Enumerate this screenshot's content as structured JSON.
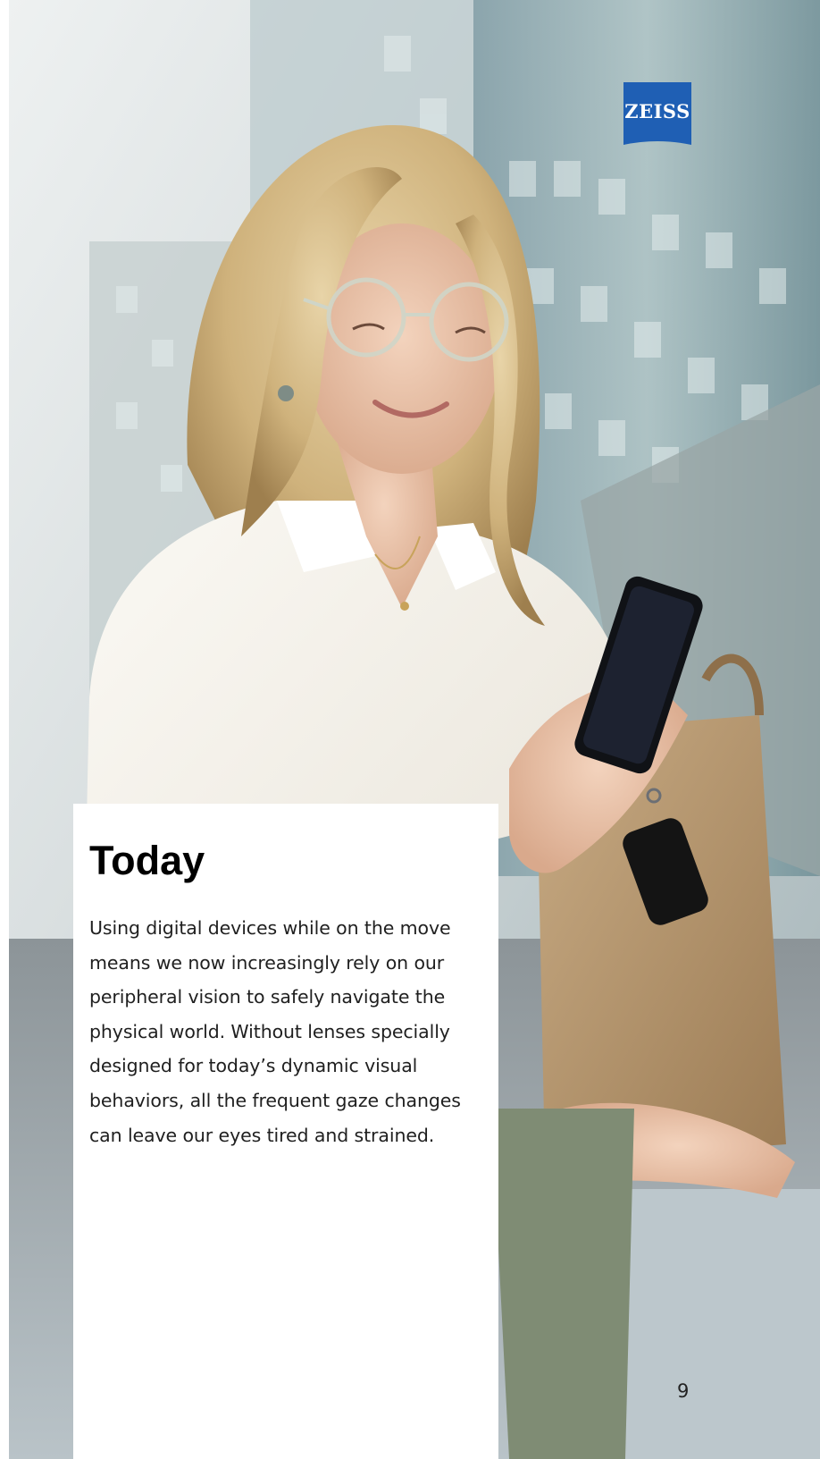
{
  "brand": {
    "logo_text": "ZEISS",
    "logo_color": "#1f5fb4"
  },
  "photo": {
    "icon": "woman-with-phone-photo"
  },
  "card": {
    "title": "Today",
    "body": "Using digital devices while on the move means we now increasingly rely on our peripheral vision to safely navigate the physical world. Without lenses specially designed for today’s dynamic visual behaviors, all the frequent gaze changes can leave our eyes tired and strained."
  },
  "page_number": "9"
}
